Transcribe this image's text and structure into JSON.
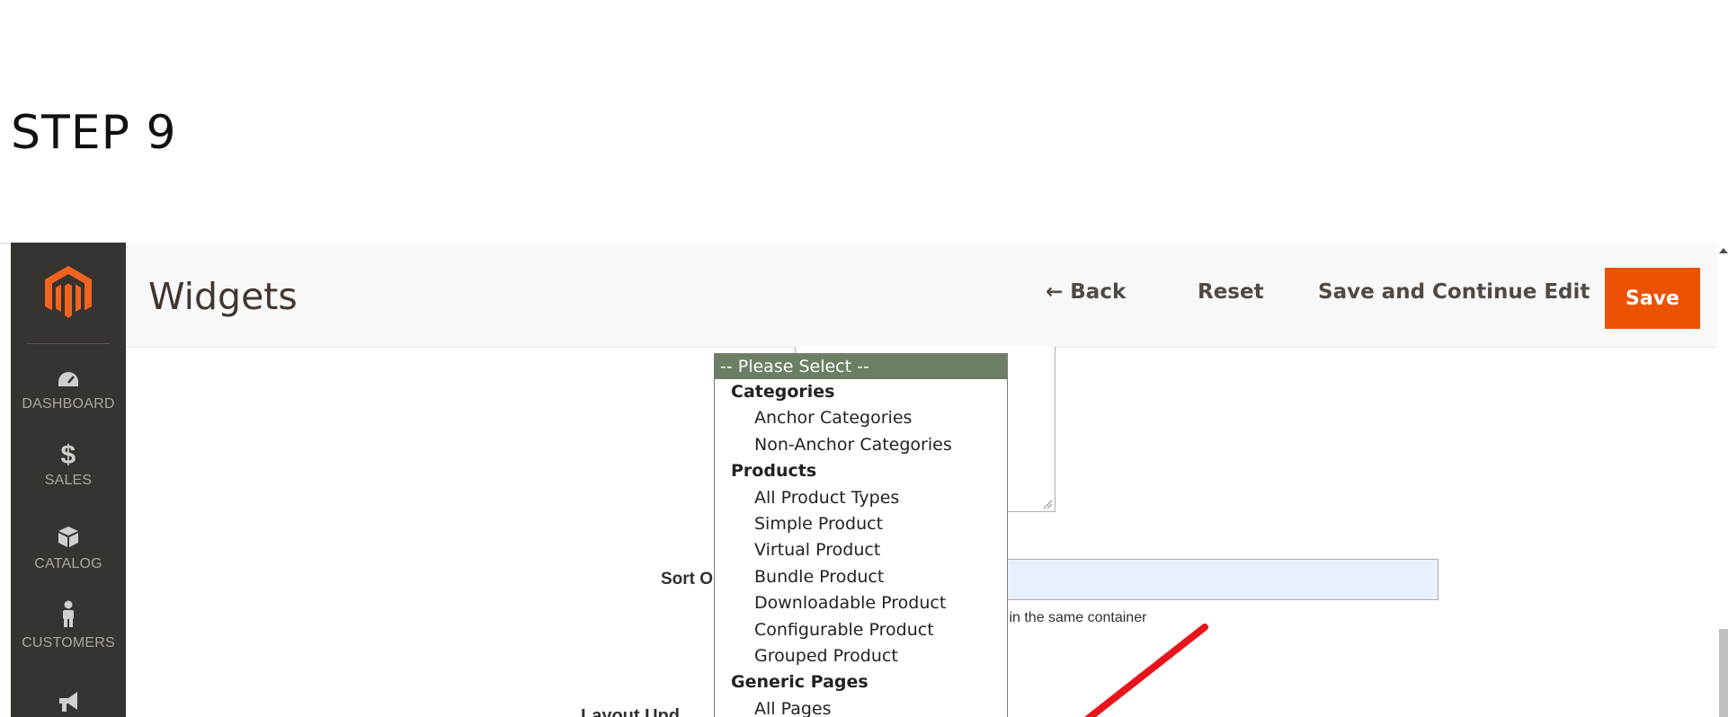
{
  "step_title": "STEP 9",
  "sidebar": {
    "items": [
      {
        "label": "DASHBOARD",
        "icon": "dashboard-icon"
      },
      {
        "label": "SALES",
        "icon": "dollar-icon"
      },
      {
        "label": "CATALOG",
        "icon": "box-icon"
      },
      {
        "label": "CUSTOMERS",
        "icon": "person-icon"
      },
      {
        "label": "",
        "icon": "megaphone-icon"
      }
    ]
  },
  "header": {
    "title": "Widgets",
    "back_label": "← Back",
    "reset_label": "Reset",
    "save_continue_label": "Save and Continue Edit",
    "save_label": "Save"
  },
  "form": {
    "sort_label_visible": "Sort O",
    "sort_note_visible": "s in the same container",
    "layout_label_visible": "Layout Upd"
  },
  "dropdown": {
    "selected": "-- Please Select --",
    "groups": [
      {
        "label": "Categories",
        "options": [
          "Anchor Categories",
          "Non-Anchor Categories"
        ]
      },
      {
        "label": "Products",
        "options": [
          "All Product Types",
          "Simple Product",
          "Virtual Product",
          "Bundle Product",
          "Downloadable Product",
          "Configurable Product",
          "Grouped Product"
        ]
      },
      {
        "label": "Generic Pages",
        "options": [
          "All Pages"
        ]
      }
    ]
  },
  "colors": {
    "sidebar_bg": "#373330",
    "brand_orange": "#eb5202",
    "dropdown_selected_bg": "#6b7f65",
    "annotation_arrow": "#e8141b"
  }
}
